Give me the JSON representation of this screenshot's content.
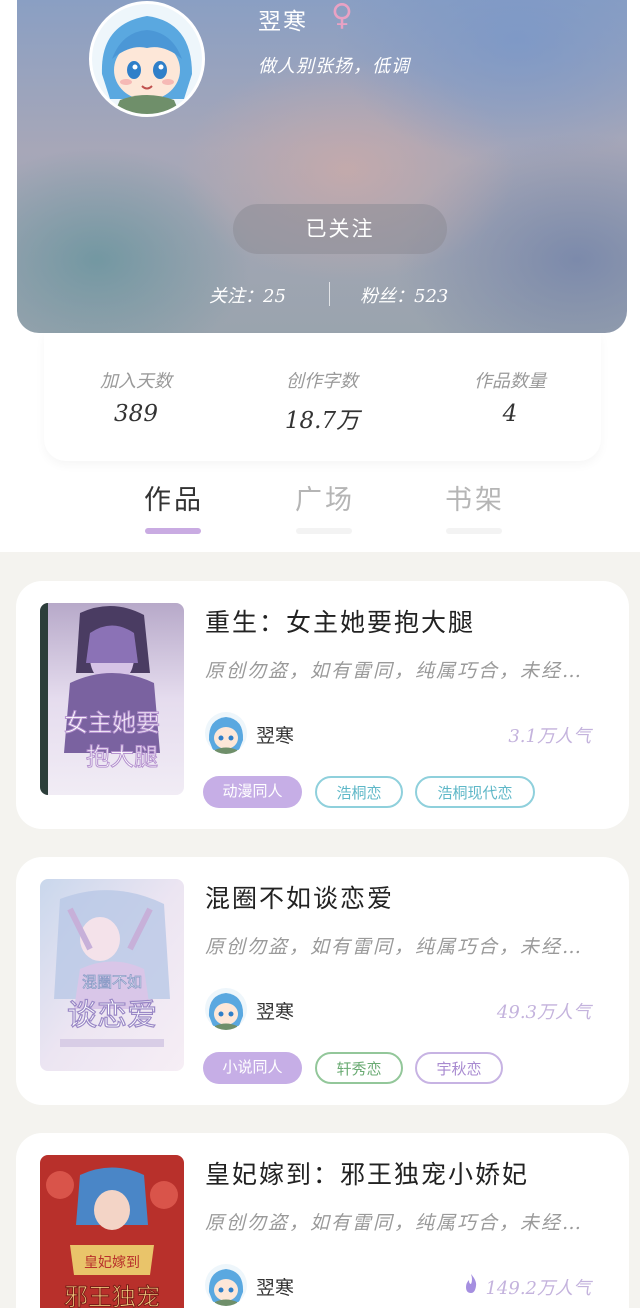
{
  "profile": {
    "name": "翌寒",
    "gender_symbol": "♀",
    "motto": "做人别张扬，低调",
    "follow_button": "已关注",
    "following": "关注：25",
    "fans": "粉丝：523"
  },
  "info": [
    {
      "label": "加入天数",
      "value": "389"
    },
    {
      "label": "创作字数",
      "value": "18.7万"
    },
    {
      "label": "作品数量",
      "value": "4"
    }
  ],
  "tabs": [
    {
      "label": "作品",
      "active": true
    },
    {
      "label": "广场",
      "active": false
    },
    {
      "label": "书架",
      "active": false
    }
  ],
  "works": [
    {
      "title": "重生：女主她要抱大腿",
      "desc": "原创勿盗，如有雷同，纯属巧合，未经…",
      "author": "翌寒",
      "popularity": "3.1万人气",
      "tags": [
        "动漫同人",
        "浩桐恋",
        "浩桐现代恋"
      ]
    },
    {
      "title": "混圈不如谈恋爱",
      "desc": "原创勿盗，如有雷同，纯属巧合，未经…",
      "author": "翌寒",
      "popularity": "49.3万人气",
      "tags": [
        "小说同人",
        "轩秀恋",
        "宇秋恋"
      ]
    },
    {
      "title": "皇妃嫁到：邪王独宠小娇妃",
      "desc": "原创勿盗，如有雷同，纯属巧合，未经…",
      "author": "翌寒",
      "popularity": "149.2万人气",
      "tags": []
    }
  ],
  "cover_texts": {
    "cover1": "女主她要抱大腿",
    "cover2": "混圈不如谈恋爱",
    "cover3": "皇妃嫁到 邪王独宠"
  },
  "colors": {
    "accent": "#c9abe2",
    "popularity": "#c4b3dd",
    "tag_filled": "#c6aee6",
    "background": "#f4f3ef"
  },
  "icons": {
    "gender": "female-symbol-icon",
    "popularity": "flame-icon"
  }
}
